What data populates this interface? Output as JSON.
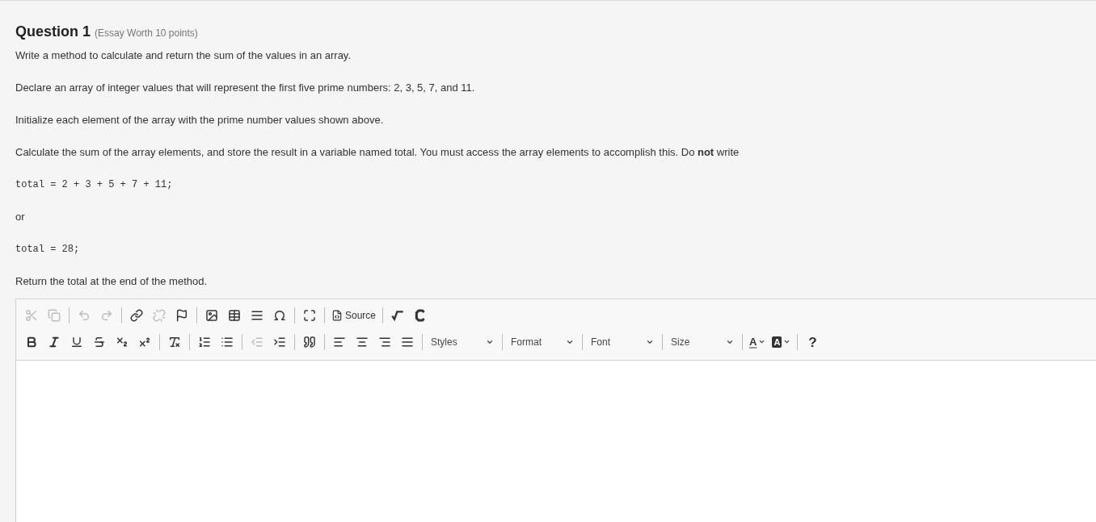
{
  "question": {
    "title": "Question 1",
    "meta": "(Essay Worth 10 points)"
  },
  "body": [
    {
      "kind": "text",
      "text": "Write a method to calculate and return the sum of the values in an array."
    },
    {
      "kind": "text",
      "text": "Declare an array of integer values that will represent the first five prime numbers: 2, 3, 5, 7, and 11."
    },
    {
      "kind": "text",
      "text": "Initialize each element of the array with the prime number values shown above."
    },
    {
      "kind": "text",
      "text": "Calculate the sum of the array elements, and store the result in a variable named total. You must access the array elements to accomplish this. Do **not** write"
    },
    {
      "kind": "code",
      "text": "total = 2 + 3 + 5 + 7 + 11;"
    },
    {
      "kind": "text",
      "text": "or"
    },
    {
      "kind": "code",
      "text": "total = 28;"
    },
    {
      "kind": "text",
      "text": "Return the total at the end of the method."
    }
  ],
  "toolbar": [
    [
      [
        {
          "kind": "icon",
          "disabled": true
        },
        {
          "kind": "icon",
          "disabled": true
        }
      ],
      [
        {
          "kind": "icon",
          "disabled": true
        },
        {
          "kind": "icon",
          "disabled": true
        }
      ],
      [
        {
          "kind": "icon",
          "disabled": false
        },
        {
          "kind": "icon",
          "disabled": true
        },
        {
          "kind": "icon",
          "disabled": false
        }
      ],
      [
        {
          "kind": "icon",
          "disabled": false
        },
        {
          "kind": "icon",
          "disabled": false
        },
        {
          "kind": "icon",
          "disabled": false
        },
        {
          "kind": "icon",
          "disabled": false
        }
      ],
      [
        {
          "kind": "icon",
          "disabled": false
        }
      ],
      [
        {
          "kind": "labeled",
          "label": "Source",
          "disabled": false
        }
      ],
      [
        {
          "kind": "icon",
          "disabled": false
        },
        {
          "kind": "icon",
          "disabled": false
        }
      ]
    ],
    [
      [
        {
          "kind": "icon",
          "disabled": false
        },
        {
          "kind": "icon",
          "disabled": false
        },
        {
          "kind": "icon",
          "disabled": false
        },
        {
          "kind": "icon",
          "disabled": false
        },
        {
          "kind": "icon",
          "disabled": false
        },
        {
          "kind": "icon",
          "disabled": false
        }
      ],
      [
        {
          "kind": "icon",
          "disabled": false
        }
      ],
      [
        {
          "kind": "icon",
          "disabled": false
        },
        {
          "kind": "icon",
          "disabled": false
        }
      ],
      [
        {
          "kind": "icon",
          "disabled": true
        },
        {
          "kind": "icon",
          "disabled": false
        }
      ],
      [
        {
          "kind": "icon",
          "disabled": false
        }
      ],
      [
        {
          "kind": "icon",
          "disabled": false
        },
        {
          "kind": "icon",
          "disabled": false
        },
        {
          "kind": "icon",
          "disabled": false
        },
        {
          "kind": "icon",
          "disabled": false
        }
      ],
      [
        {
          "kind": "dropdown",
          "label": "Styles"
        }
      ],
      [
        {
          "kind": "dropdown",
          "label": "Format"
        }
      ],
      [
        {
          "kind": "dropdown",
          "label": "Font"
        }
      ],
      [
        {
          "kind": "dropdown",
          "label": "Size"
        }
      ],
      [
        {
          "kind": "color",
          "label": "A"
        },
        {
          "kind": "bgcolor",
          "label": "A"
        }
      ],
      [
        {
          "kind": "help",
          "label": "?"
        }
      ]
    ]
  ]
}
